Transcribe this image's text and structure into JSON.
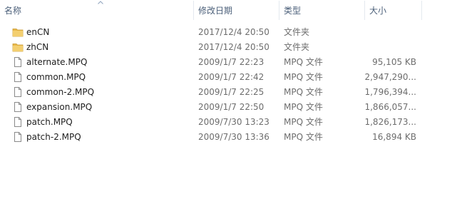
{
  "columns": {
    "name": "名称",
    "date": "修改日期",
    "type": "类型",
    "size": "大小"
  },
  "files": [
    {
      "name": "enCN",
      "date": "2017/12/4 20:50",
      "type": "文件夹",
      "size": "",
      "icon": "folder-icon"
    },
    {
      "name": "zhCN",
      "date": "2017/12/4 20:50",
      "type": "文件夹",
      "size": "",
      "icon": "folder-icon"
    },
    {
      "name": "alternate.MPQ",
      "date": "2009/1/7 22:23",
      "type": "MPQ 文件",
      "size": "95,105 KB",
      "icon": "file-icon"
    },
    {
      "name": "common.MPQ",
      "date": "2009/1/7 22:42",
      "type": "MPQ 文件",
      "size": "2,947,290...",
      "icon": "file-icon"
    },
    {
      "name": "common-2.MPQ",
      "date": "2009/1/7 22:25",
      "type": "MPQ 文件",
      "size": "1,796,394...",
      "icon": "file-icon"
    },
    {
      "name": "expansion.MPQ",
      "date": "2009/1/7 22:50",
      "type": "MPQ 文件",
      "size": "1,866,057...",
      "icon": "file-icon"
    },
    {
      "name": "patch.MPQ",
      "date": "2009/7/30 13:23",
      "type": "MPQ 文件",
      "size": "1,826,173...",
      "icon": "file-icon"
    },
    {
      "name": "patch-2.MPQ",
      "date": "2009/7/30 13:36",
      "type": "MPQ 文件",
      "size": "16,894 KB",
      "icon": "file-icon"
    }
  ],
  "colors": {
    "header_text": "#4c607a",
    "name_text": "#1e1e1e",
    "meta_text": "#6d6d6d",
    "folder_yellow": "#e8b84a"
  }
}
